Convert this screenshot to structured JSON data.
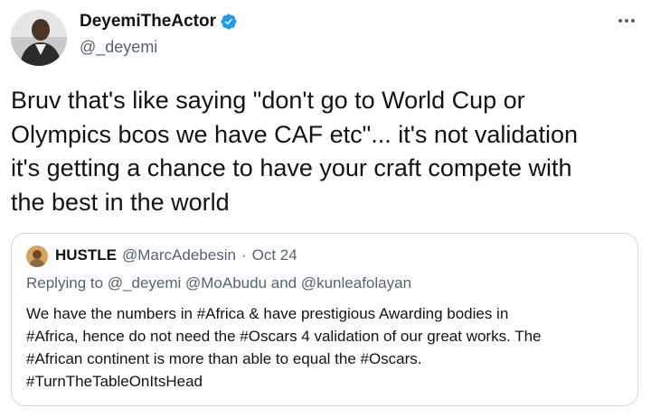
{
  "tweet": {
    "display_name": "DeyemiTheActor",
    "handle": "@_deyemi",
    "verified": true,
    "more_icon": "more-horizontal-icon",
    "text": "Bruv that's like saying \"don't go to World Cup or\nOlympics bcos we have CAF etc\"... it's not validation\nit's getting a chance to have your craft compete with\nthe best in the world"
  },
  "quote": {
    "display_name": "HUSTLE",
    "handle": "@MarcAdebesin",
    "separator": "·",
    "date": "Oct 24",
    "replying_to": "Replying to @_deyemi @MoAbudu and @kunleafolayan",
    "text": "We have the numbers in #Africa & have prestigious Awarding bodies in\n#Africa, hence do not need the #Oscars 4 validation of our great works. The\n#African continent is more than able to equal the #Oscars.\n#TurnTheTableOnItsHead"
  },
  "colors": {
    "text_primary": "#0f1419",
    "text_secondary": "#536471",
    "verified_blue": "#1d9bf0",
    "border": "#cfd9de"
  }
}
